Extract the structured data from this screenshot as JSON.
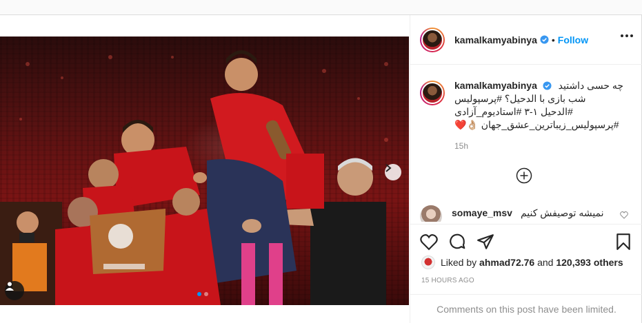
{
  "header": {
    "username": "kamalkamyabinya",
    "separator": "•",
    "follow_label": "Follow"
  },
  "caption": {
    "username": "kamalkamyabinya",
    "lines": [
      "چه حسی داشتید",
      "شب بازی با الدحیل؟ #پرسپولیس",
      "#الدحیل ۱-۳ #استادیوم_آزادی",
      "#پرسپولیس_زیباترین_عشق_جهان 👌🏼❤️"
    ],
    "time": "15h"
  },
  "comment": {
    "username": "somaye_msv",
    "text": "نمیشه توصیفش کنیم"
  },
  "likes": {
    "prefix": "Liked by",
    "user": "ahmad72.76",
    "conj": "and",
    "count": "120,393 others"
  },
  "timestamp": "15 HOURS AGO",
  "comments_limited": "Comments on this post have been limited.",
  "icons": {
    "header": [
      "verified-icon",
      "more-options-icon"
    ],
    "actions": [
      "like-icon",
      "comment-icon",
      "share-icon",
      "save-icon"
    ],
    "media": [
      "next-arrow-icon",
      "tagged-users-icon"
    ],
    "caption": [
      "add-comment-icon"
    ]
  },
  "colors": {
    "accent": "#0095f6",
    "hashtag": "#00376b",
    "muted": "#8e8e8e",
    "jersey_red": "#c8141a"
  },
  "carousel": {
    "slides": 2,
    "current": 1
  }
}
